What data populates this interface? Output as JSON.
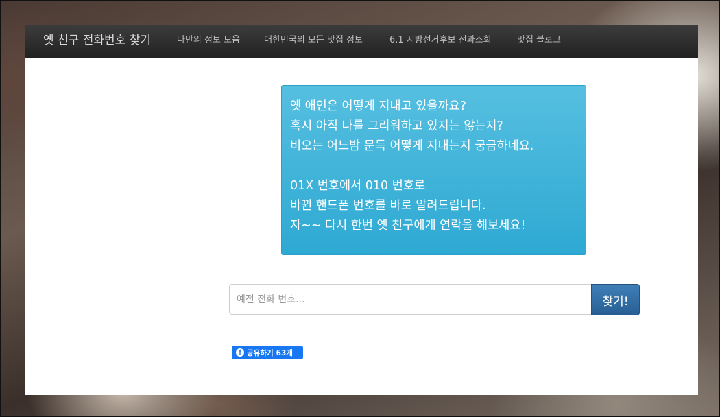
{
  "navbar": {
    "brand": "옛 친구 전화번호 찾기",
    "links": [
      {
        "label": "나만의 정보 모음"
      },
      {
        "label": "대한민국의 모든 맛집 정보"
      },
      {
        "label": "6.1 지방선거후보 전과조회"
      },
      {
        "label": "맛집 블로그"
      }
    ]
  },
  "message": {
    "paragraph1": [
      "옛 애인은 어떻게 지내고 있을까요?",
      "혹시 아직 나를 그리워하고 있지는 않는지?",
      "비오는 어느밤 문득 어떻게 지내는지 궁금하네요."
    ],
    "paragraph2": [
      "01X 번호에서 010 번호로",
      "바뀐 핸드폰 번호를 바로 알려드립니다.",
      "자~~ 다시 한번 옛 친구에게 연락을 해보세요!"
    ]
  },
  "search": {
    "placeholder": "예전 전화 번호...",
    "value": "",
    "button_label": "찾기!"
  },
  "share": {
    "label": "공유하기",
    "count": "63개",
    "icon": "facebook-icon"
  },
  "colors": {
    "navbar": "#2b2b2b",
    "message_box": "#3bb1d9",
    "search_button": "#2f6ea5",
    "facebook": "#1877f2"
  }
}
